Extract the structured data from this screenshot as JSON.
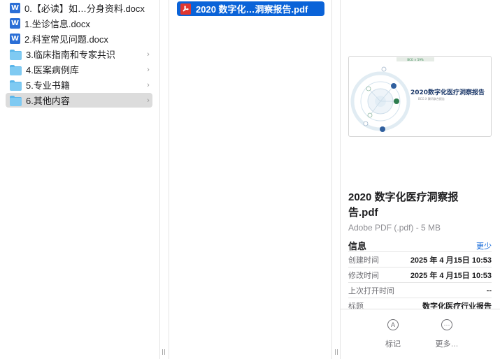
{
  "sidebar": {
    "items": [
      {
        "label": "0.【必读】如…分身资料.docx",
        "kind": "word",
        "icon": "word-doc-icon"
      },
      {
        "label": "1.坐诊信息.docx",
        "kind": "word",
        "icon": "word-doc-icon"
      },
      {
        "label": "2.科室常见问题.docx",
        "kind": "word",
        "icon": "word-doc-icon"
      },
      {
        "label": "3.临床指南和专家共识",
        "kind": "folder",
        "icon": "folder-icon"
      },
      {
        "label": "4.医案病例库",
        "kind": "folder",
        "icon": "folder-icon"
      },
      {
        "label": "5.专业书籍",
        "kind": "folder",
        "icon": "folder-icon"
      },
      {
        "label": "6.其他内容",
        "kind": "folder",
        "icon": "folder-icon",
        "selected": true
      }
    ]
  },
  "middle": {
    "selected_file": "2020 数字化…洞察报告.pdf",
    "icon": "pdf-icon"
  },
  "preview": {
    "thumbnail": {
      "header_text": "BCG × 59%",
      "title": "2020数字化医疗洞察报告",
      "subtitle": "BCG X 腾讯联合报告"
    },
    "file_name": "2020 数字化医疗洞察报告.pdf",
    "file_type": "Adobe PDF (.pdf) - 5 MB",
    "info_title": "信息",
    "less_label": "更少",
    "info_rows": [
      {
        "key": "创建时间",
        "value": "2025 年 4 月15日 10:53"
      },
      {
        "key": "修改时间",
        "value": "2025 年 4 月15日 10:53"
      },
      {
        "key": "上次打开时间",
        "value": "--"
      },
      {
        "key": "标题",
        "value": "数字化医疗行业报告"
      }
    ],
    "actions": [
      {
        "label": "标记",
        "icon": "markup-icon",
        "glyph": "A"
      },
      {
        "label": "更多…",
        "icon": "more-icon",
        "glyph": "···"
      }
    ]
  },
  "colors": {
    "selection": "#0a63d8",
    "folder": "#7fcaf2",
    "word": "#2b6fd6",
    "pdf": "#e0362f"
  }
}
